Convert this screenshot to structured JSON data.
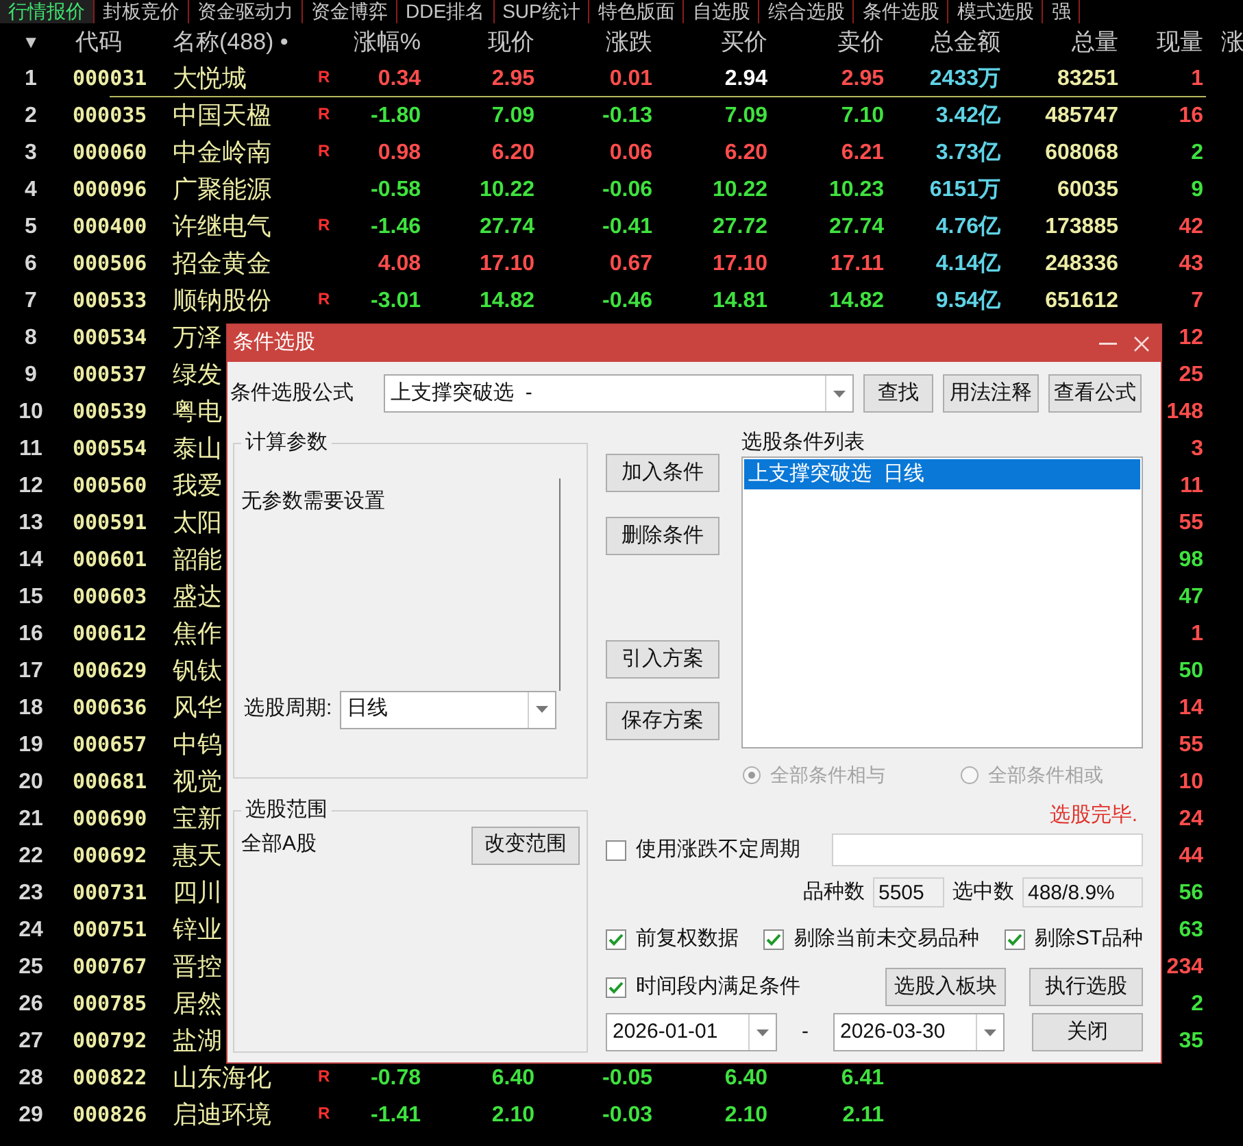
{
  "tabs": [
    {
      "label": "行情报价",
      "selected": true
    },
    {
      "label": "封板竞价",
      "selected": false
    },
    {
      "label": "资金驱动力",
      "selected": false
    },
    {
      "label": "资金博弈",
      "selected": false
    },
    {
      "label": "DDE排名",
      "selected": false
    },
    {
      "label": "SUP统计",
      "selected": false
    },
    {
      "label": "特色版面",
      "selected": false
    },
    {
      "label": "自选股",
      "selected": false
    },
    {
      "label": "综合选股",
      "selected": false
    },
    {
      "label": "条件选股",
      "selected": false
    },
    {
      "label": "模式选股",
      "selected": false
    },
    {
      "label": "强",
      "selected": false
    }
  ],
  "table": {
    "sort_marker": "▼",
    "columns": [
      "代码",
      "名称(488) •",
      "涨幅%",
      "现价",
      "涨跌",
      "买价",
      "卖价",
      "总金额",
      "总量",
      "现量",
      "涨"
    ],
    "rows": [
      {
        "index": "1",
        "code": "000031",
        "name": "大悦城",
        "flag": "R",
        "change_pct": {
          "text": "0.34",
          "color": "#ff4d4d"
        },
        "price": {
          "text": "2.95",
          "color": "#ff4d4d"
        },
        "change": {
          "text": "0.01",
          "color": "#ff4d4d"
        },
        "bid": {
          "text": "2.94",
          "color": "#ffffff"
        },
        "ask": {
          "text": "2.95",
          "color": "#ff4d4d"
        },
        "amount": "2433万",
        "volume": "83251",
        "volume_now": {
          "text": "1",
          "color": "#ff4d4d"
        }
      },
      {
        "index": "2",
        "code": "000035",
        "name": "中国天楹",
        "flag": "R",
        "change_pct": {
          "text": "-1.80",
          "color": "#3fe23f"
        },
        "price": {
          "text": "7.09",
          "color": "#3fe23f"
        },
        "change": {
          "text": "-0.13",
          "color": "#3fe23f"
        },
        "bid": {
          "text": "7.09",
          "color": "#3fe23f"
        },
        "ask": {
          "text": "7.10",
          "color": "#3fe23f"
        },
        "amount": "3.42亿",
        "volume": "485747",
        "volume_now": {
          "text": "16",
          "color": "#ff4d4d"
        }
      },
      {
        "index": "3",
        "code": "000060",
        "name": "中金岭南",
        "flag": "R",
        "change_pct": {
          "text": "0.98",
          "color": "#ff4d4d"
        },
        "price": {
          "text": "6.20",
          "color": "#ff4d4d"
        },
        "change": {
          "text": "0.06",
          "color": "#ff4d4d"
        },
        "bid": {
          "text": "6.20",
          "color": "#ff4d4d"
        },
        "ask": {
          "text": "6.21",
          "color": "#ff4d4d"
        },
        "amount": "3.73亿",
        "volume": "608068",
        "volume_now": {
          "text": "2",
          "color": "#3fe23f"
        }
      },
      {
        "index": "4",
        "code": "000096",
        "name": "广聚能源",
        "change_pct": {
          "text": "-0.58",
          "color": "#3fe23f"
        },
        "price": {
          "text": "10.22",
          "color": "#3fe23f"
        },
        "change": {
          "text": "-0.06",
          "color": "#3fe23f"
        },
        "bid": {
          "text": "10.22",
          "color": "#3fe23f"
        },
        "ask": {
          "text": "10.23",
          "color": "#3fe23f"
        },
        "amount": "6151万",
        "volume": "60035",
        "volume_now": {
          "text": "9",
          "color": "#3fe23f"
        }
      },
      {
        "index": "5",
        "code": "000400",
        "name": "许继电气",
        "flag": "R",
        "change_pct": {
          "text": "-1.46",
          "color": "#3fe23f"
        },
        "price": {
          "text": "27.74",
          "color": "#3fe23f"
        },
        "change": {
          "text": "-0.41",
          "color": "#3fe23f"
        },
        "bid": {
          "text": "27.72",
          "color": "#3fe23f"
        },
        "ask": {
          "text": "27.74",
          "color": "#3fe23f"
        },
        "amount": "4.76亿",
        "volume": "173885",
        "volume_now": {
          "text": "42",
          "color": "#ff4d4d"
        }
      },
      {
        "index": "6",
        "code": "000506",
        "name": "招金黄金",
        "change_pct": {
          "text": "4.08",
          "color": "#ff4d4d"
        },
        "price": {
          "text": "17.10",
          "color": "#ff4d4d"
        },
        "change": {
          "text": "0.67",
          "color": "#ff4d4d"
        },
        "bid": {
          "text": "17.10",
          "color": "#ff4d4d"
        },
        "ask": {
          "text": "17.11",
          "color": "#ff4d4d"
        },
        "amount": "4.14亿",
        "volume": "248336",
        "volume_now": {
          "text": "43",
          "color": "#ff4d4d"
        }
      },
      {
        "index": "7",
        "code": "000533",
        "name": "顺钠股份",
        "flag": "R",
        "change_pct": {
          "text": "-3.01",
          "color": "#3fe23f"
        },
        "price": {
          "text": "14.82",
          "color": "#3fe23f"
        },
        "change": {
          "text": "-0.46",
          "color": "#3fe23f"
        },
        "bid": {
          "text": "14.81",
          "color": "#3fe23f"
        },
        "ask": {
          "text": "14.82",
          "color": "#3fe23f"
        },
        "amount": "9.54亿",
        "volume": "651612",
        "volume_now": {
          "text": "7",
          "color": "#ff4d4d"
        }
      },
      {
        "index": "8",
        "code": "000534",
        "name": "万泽",
        "volume_now": {
          "text": "12",
          "color": "#ff4d4d"
        }
      },
      {
        "index": "9",
        "code": "000537",
        "name": "绿发",
        "volume_now": {
          "text": "25",
          "color": "#ff4d4d"
        }
      },
      {
        "index": "10",
        "code": "000539",
        "name": "粤电",
        "volume_now": {
          "text": "148",
          "color": "#ff4d4d"
        }
      },
      {
        "index": "11",
        "code": "000554",
        "name": "泰山",
        "volume_now": {
          "text": "3",
          "color": "#ff4d4d"
        }
      },
      {
        "index": "12",
        "code": "000560",
        "name": "我爱",
        "volume_now": {
          "text": "11",
          "color": "#ff4d4d"
        }
      },
      {
        "index": "13",
        "code": "000591",
        "name": "太阳",
        "volume_now": {
          "text": "55",
          "color": "#ff4d4d"
        }
      },
      {
        "index": "14",
        "code": "000601",
        "name": "韶能",
        "volume_now": {
          "text": "98",
          "color": "#3fe23f"
        }
      },
      {
        "index": "15",
        "code": "000603",
        "name": "盛达",
        "volume_now": {
          "text": "47",
          "color": "#3fe23f"
        }
      },
      {
        "index": "16",
        "code": "000612",
        "name": "焦作",
        "volume_now": {
          "text": "1",
          "color": "#ff4d4d"
        }
      },
      {
        "index": "17",
        "code": "000629",
        "name": "钒钛",
        "volume_now": {
          "text": "50",
          "color": "#3fe23f"
        }
      },
      {
        "index": "18",
        "code": "000636",
        "name": "风华",
        "volume_now": {
          "text": "14",
          "color": "#ff4d4d"
        }
      },
      {
        "index": "19",
        "code": "000657",
        "name": "中钨",
        "volume_now": {
          "text": "55",
          "color": "#ff4d4d"
        }
      },
      {
        "index": "20",
        "code": "000681",
        "name": "视觉",
        "volume_now": {
          "text": "10",
          "color": "#ff4d4d"
        }
      },
      {
        "index": "21",
        "code": "000690",
        "name": "宝新",
        "volume_now": {
          "text": "24",
          "color": "#ff4d4d"
        }
      },
      {
        "index": "22",
        "code": "000692",
        "name": "惠天",
        "volume_now": {
          "text": "44",
          "color": "#ff4d4d"
        }
      },
      {
        "index": "23",
        "code": "000731",
        "name": "四川",
        "volume_now": {
          "text": "56",
          "color": "#3fe23f"
        }
      },
      {
        "index": "24",
        "code": "000751",
        "name": "锌业",
        "volume_now": {
          "text": "63",
          "color": "#3fe23f"
        }
      },
      {
        "index": "25",
        "code": "000767",
        "name": "晋控",
        "volume_now": {
          "text": "234",
          "color": "#ff4d4d"
        }
      },
      {
        "index": "26",
        "code": "000785",
        "name": "居然",
        "volume_now": {
          "text": "2",
          "color": "#3fe23f"
        }
      },
      {
        "index": "27",
        "code": "000792",
        "name": "盐湖",
        "volume_now": {
          "text": "35",
          "color": "#3fe23f"
        }
      },
      {
        "index": "28",
        "code": "000822",
        "name": "山东海化",
        "flag": "R",
        "change_pct": {
          "text": "-0.78",
          "color": "#3fe23f"
        },
        "price": {
          "text": "6.40",
          "color": "#3fe23f"
        },
        "change": {
          "text": "-0.05",
          "color": "#3fe23f"
        },
        "bid": {
          "text": "6.40",
          "color": "#3fe23f"
        },
        "ask": {
          "text": "6.41",
          "color": "#3fe23f"
        }
      },
      {
        "index": "29",
        "code": "000826",
        "name": "启迪环境",
        "flag": "R",
        "change_pct": {
          "text": "-1.41",
          "color": "#3fe23f"
        },
        "price": {
          "text": "2.10",
          "color": "#3fe23f"
        },
        "change": {
          "text": "-0.03",
          "color": "#3fe23f"
        },
        "bid": {
          "text": "2.10",
          "color": "#3fe23f"
        },
        "ask": {
          "text": "2.11",
          "color": "#3fe23f"
        }
      }
    ]
  },
  "dialog": {
    "title": "条件选股",
    "formula": {
      "label": "条件选股公式",
      "value": "上支撑突破选  -"
    },
    "top_buttons": [
      "查找",
      "用法注释",
      "查看公式"
    ],
    "params": {
      "title": "计算参数",
      "message": "无参数需要设置",
      "period_label": "选股周期:",
      "period_value": "日线"
    },
    "action_buttons": [
      "加入条件",
      "删除条件",
      "引入方案",
      "保存方案"
    ],
    "conditions": {
      "title": "选股条件列表",
      "items": [
        {
          "text": "上支撑突破选  日线",
          "selected": true
        }
      ]
    },
    "logic": [
      {
        "label": "全部条件相与",
        "selected": true,
        "disabled": true
      },
      {
        "label": "全部条件相或",
        "selected": false,
        "disabled": true
      }
    ],
    "status": "选股完毕.",
    "scope": {
      "title": "选股范围",
      "value": "全部A股",
      "button": "改变范围"
    },
    "variable_period": {
      "label": "使用涨跌不定周期",
      "checked": false
    },
    "counts": [
      {
        "label": "品种数",
        "value": "5505"
      },
      {
        "label": "选中数",
        "value": "488/8.9%"
      }
    ],
    "options": [
      {
        "label": "前复权数据",
        "checked": true
      },
      {
        "label": "剔除当前未交易品种",
        "checked": true
      },
      {
        "label": "剔除ST品种",
        "checked": true
      }
    ],
    "period_filter": {
      "label": "时间段内满足条件",
      "checked": true
    },
    "block_button": "选股入板块",
    "run_button": "执行选股",
    "date_from": "2026-01-01",
    "date_separator": "-",
    "date_to": "2026-03-30",
    "close_button": "关闭"
  }
}
